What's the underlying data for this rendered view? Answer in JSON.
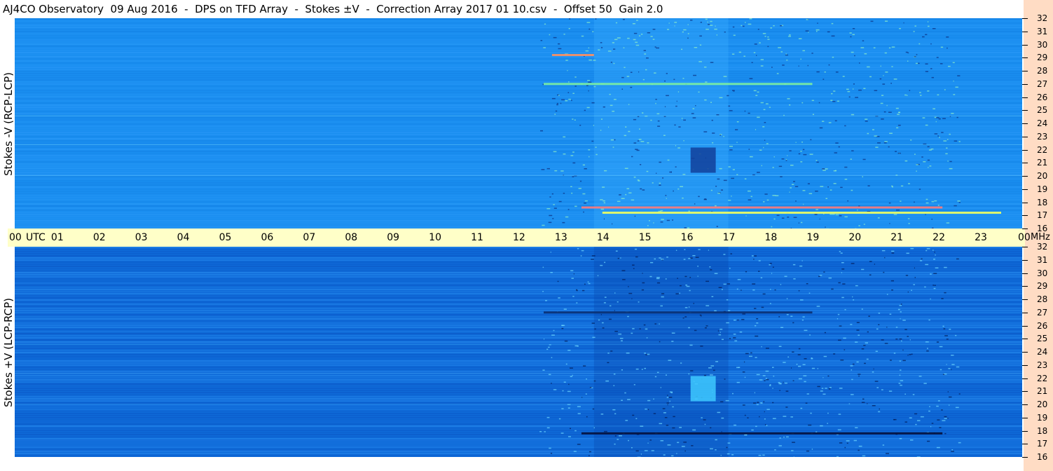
{
  "title": "AJ4CO Observatory  09 Aug 2016  -  DPS on TFD Array  -  Stokes ±V  -  Correction Array 2017 01 10.csv  -  Offset 50  Gain 2.0",
  "chart_data": {
    "type": "heatmap",
    "x_axis": {
      "unit": "UTC",
      "range": [
        0,
        24
      ],
      "ticks": [
        "00",
        "01",
        "02",
        "03",
        "04",
        "05",
        "06",
        "07",
        "08",
        "09",
        "10",
        "11",
        "12",
        "13",
        "14",
        "15",
        "16",
        "17",
        "18",
        "19",
        "20",
        "21",
        "22",
        "23",
        "00"
      ]
    },
    "y_axis": {
      "unit": "MHz",
      "range": [
        16,
        32
      ],
      "ticks": [
        "16",
        "17",
        "18",
        "19",
        "20",
        "21",
        "22",
        "23",
        "24",
        "25",
        "26",
        "27",
        "28",
        "29",
        "30",
        "31",
        "32"
      ]
    },
    "panels": [
      {
        "name": "Stokes -V (RCP-LCP)",
        "background_color": "#1a8ef0",
        "features": [
          {
            "freq_mhz": 17.6,
            "utc_range": [
              13.5,
              22.1
            ],
            "color": "#ff7a7a"
          },
          {
            "freq_mhz": 17.2,
            "utc_range": [
              14.0,
              23.5
            ],
            "color": "#f0ff60"
          },
          {
            "freq_mhz": 27.0,
            "utc_range": [
              12.6,
              19.0
            ],
            "color": "#7cf0a0"
          },
          {
            "freq_mhz": 29.2,
            "utc_range": [
              12.8,
              13.8
            ],
            "color": "#ff9060"
          },
          {
            "freq_mhz": 21.2,
            "utc_range": [
              16.1,
              16.7
            ],
            "color": "#123f9a"
          }
        ]
      },
      {
        "name": "Stokes +V (LCP-RCP)",
        "background_color": "#0f6ad8",
        "features": [
          {
            "freq_mhz": 17.8,
            "utc_range": [
              13.5,
              22.1
            ],
            "color": "#04103a"
          },
          {
            "freq_mhz": 27.0,
            "utc_range": [
              12.6,
              19.0
            ],
            "color": "#0a2f70"
          },
          {
            "freq_mhz": 21.2,
            "utc_range": [
              16.1,
              16.7
            ],
            "color": "#3ec9ff"
          }
        ]
      }
    ],
    "colors": {
      "time_strip": "#ffffc8",
      "freq_strip": "#ffdcc4"
    }
  }
}
